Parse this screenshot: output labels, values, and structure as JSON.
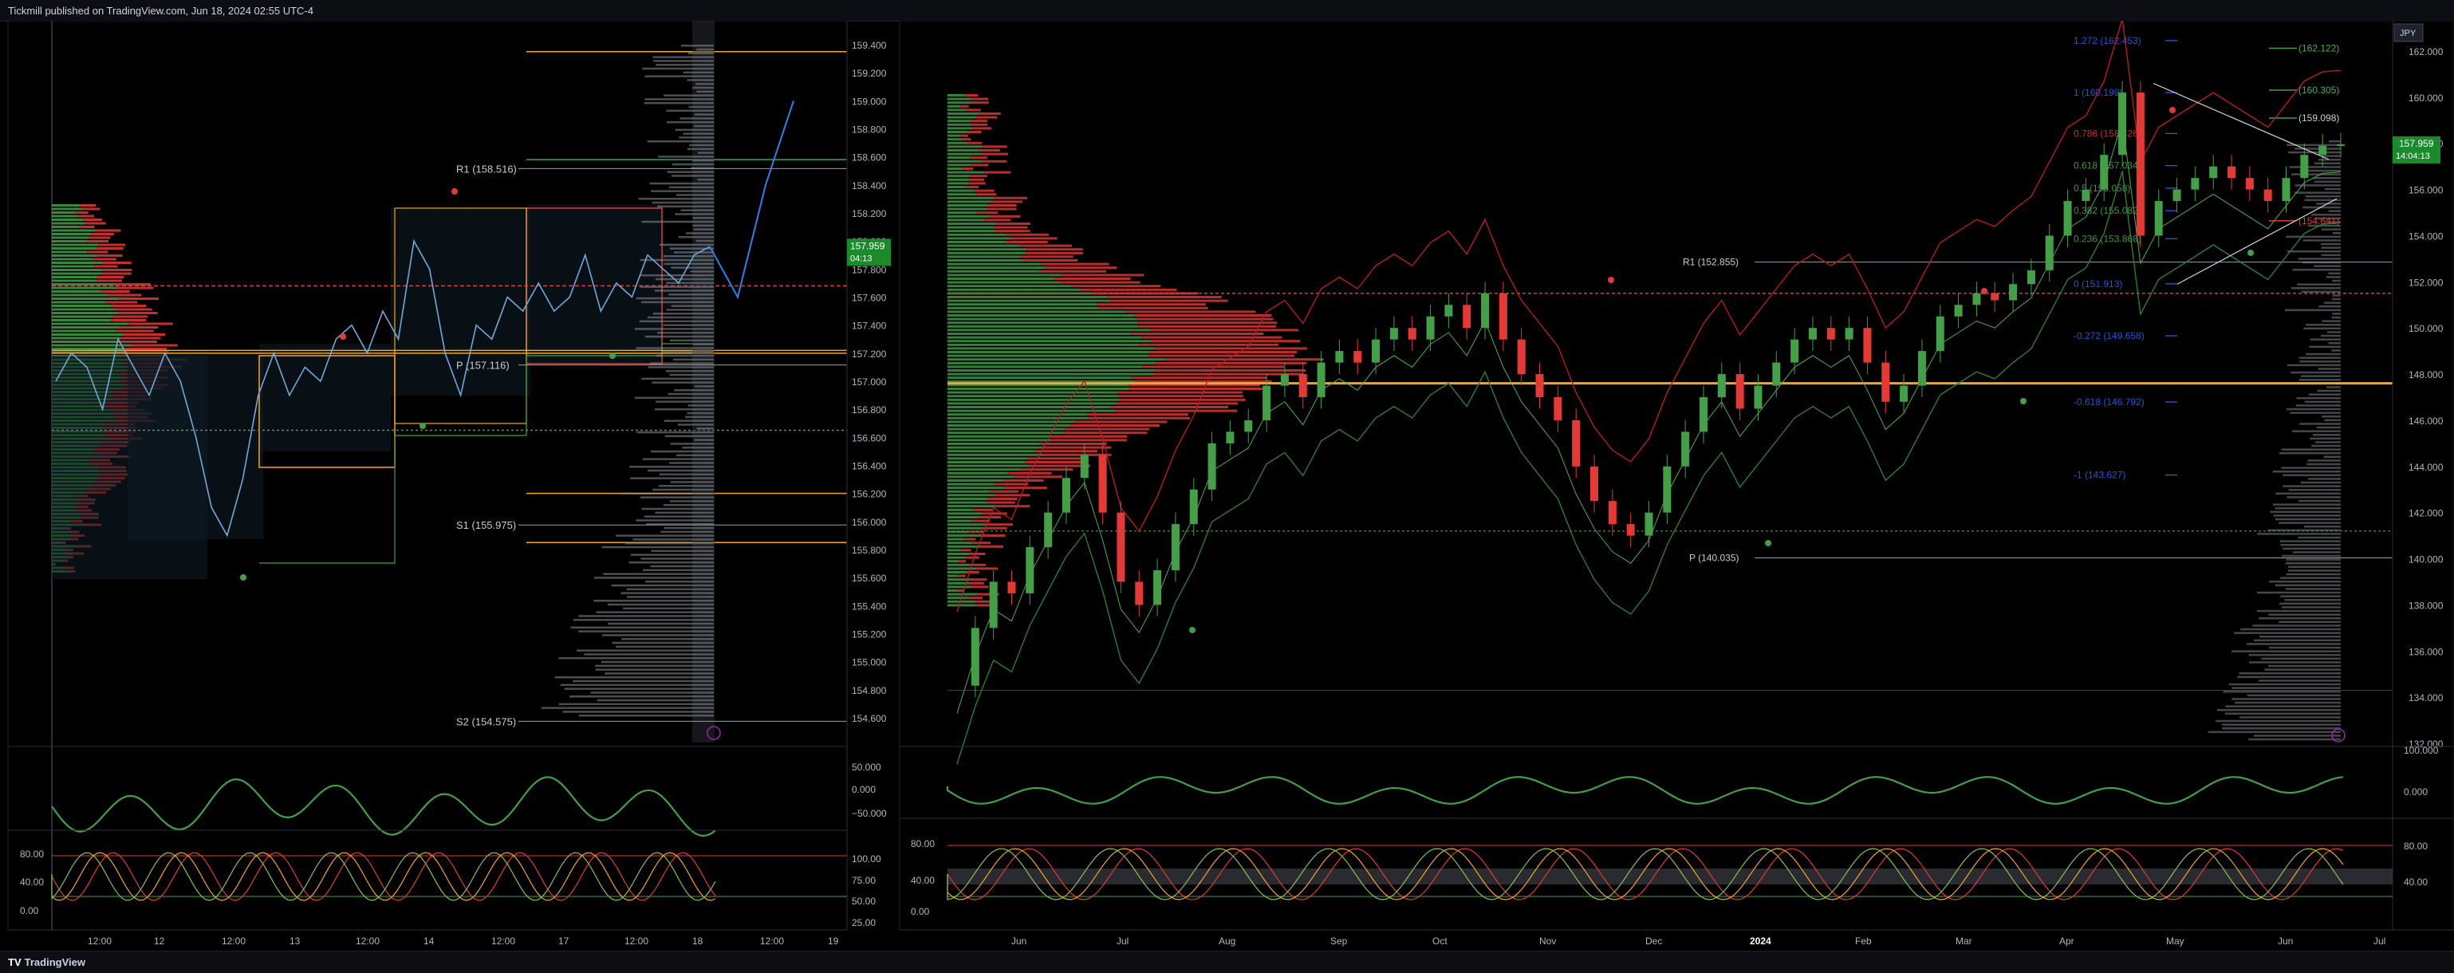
{
  "header": {
    "published": "Tickmill published on TradingView.com, Jun 18, 2024 02:55 UTC-4"
  },
  "footer": {
    "brand": "TradingView"
  },
  "colors": {
    "up": "#43a047",
    "down": "#e53935",
    "orange": "#f5a623",
    "blue": "#2962ff",
    "green_level": "#4caf50",
    "background": "#000000"
  },
  "left_panel": {
    "price_axis": [
      "159.400",
      "159.200",
      "159.000",
      "158.800",
      "158.600",
      "158.400",
      "158.200",
      "158.000",
      "157.800",
      "157.600",
      "157.400",
      "157.200",
      "157.000",
      "156.800",
      "156.600",
      "156.400",
      "156.200",
      "156.000",
      "155.800",
      "155.600",
      "155.400",
      "155.200",
      "155.000",
      "154.800",
      "154.600"
    ],
    "current_price": "157.959",
    "countdown": "04:13",
    "time_axis": [
      "12:00",
      "12",
      "12:00",
      "13",
      "12:00",
      "14",
      "12:00",
      "17",
      "12:00",
      "18",
      "12:00",
      "19"
    ],
    "levels": [
      {
        "label": "R1 (158.516)",
        "price": 158.516
      },
      {
        "label": "P (157.116)",
        "price": 157.116
      },
      {
        "label": "S1 (155.975)",
        "price": 155.975
      },
      {
        "label": "S2 (154.575)",
        "price": 154.575
      }
    ],
    "osc1_axis": [
      "50.000",
      "0.000",
      "−50.000"
    ],
    "osc2_left_axis": [
      "80.00",
      "40.00",
      "0.00"
    ],
    "osc2_right_axis": [
      "100.00",
      "75.00",
      "50.00",
      "25.00"
    ]
  },
  "right_panel": {
    "currency": "JPY",
    "price_axis": [
      "162.000",
      "160.000",
      "158.000",
      "156.000",
      "154.000",
      "152.000",
      "150.000",
      "148.000",
      "146.000",
      "144.000",
      "142.000",
      "140.000",
      "138.000",
      "136.000",
      "134.000",
      "132.000"
    ],
    "current_price": "157.959",
    "countdown": "14:04:13",
    "time_axis": [
      "Jun",
      "Jul",
      "Aug",
      "Sep",
      "Oct",
      "Nov",
      "Dec",
      "2024",
      "Feb",
      "Mar",
      "Apr",
      "May",
      "Jun",
      "Jul"
    ],
    "fib_labels": [
      {
        "label": "1.272 (162.453)",
        "price": 162.453
      },
      {
        "label": "1 (160.199)",
        "price": 160.199
      },
      {
        "label": "0.786 (158.426)",
        "price": 158.426
      },
      {
        "label": "0.618 (157.034)",
        "price": 157.034
      },
      {
        "label": "0.5 (156.058)",
        "price": 156.058
      },
      {
        "label": "0.382 (155.082)",
        "price": 155.082
      },
      {
        "label": "0.236 (153.868)",
        "price": 153.868
      },
      {
        "label": "0 (151.913)",
        "price": 151.913
      },
      {
        "label": "-0.272 (149.658)",
        "price": 149.658
      },
      {
        "label": "-0.618 (146.792)",
        "price": 146.792
      },
      {
        "label": "-1 (143.627)",
        "price": 143.627
      }
    ],
    "pivot_labels": [
      {
        "label": "R1 (152.855)",
        "price": 152.855
      },
      {
        "label": "P (140.035)",
        "price": 140.035
      }
    ],
    "right_tags": [
      {
        "label": "(162.122)",
        "price": 162.122
      },
      {
        "label": "(160.305)",
        "price": 160.305
      },
      {
        "label": "(159.098)",
        "price": 159.098
      },
      {
        "label": "(154.641)",
        "price": 154.641
      }
    ],
    "osc1_axis": [
      "100.000",
      "0.000"
    ],
    "osc2_left_axis": [
      "80.00",
      "40.00",
      "0.00"
    ],
    "osc2_right_axis": [
      "80.00",
      "40.00"
    ]
  },
  "chart_data": [
    {
      "type": "candlestick",
      "title": "",
      "timeframe_axis": [
        "12:00",
        "12",
        "12:00",
        "13",
        "12:00",
        "14",
        "12:00",
        "17",
        "12:00",
        "18",
        "12:00",
        "19"
      ],
      "ylim": [
        154.5,
        159.5
      ],
      "close_series": [
        157.0,
        157.2,
        157.1,
        156.8,
        157.3,
        157.1,
        156.9,
        157.2,
        157.0,
        156.6,
        156.1,
        155.9,
        156.3,
        156.9,
        157.2,
        156.9,
        157.1,
        157.0,
        157.3,
        157.4,
        157.2,
        157.5,
        157.3,
        158.0,
        157.8,
        157.2,
        156.9,
        157.4,
        157.3,
        157.6,
        157.5,
        157.7,
        157.5,
        157.6,
        157.9,
        157.5,
        157.7,
        157.6,
        157.9,
        157.8,
        157.7,
        157.9,
        157.96
      ],
      "projection": [
        157.96,
        157.6,
        158.4,
        159.0
      ],
      "last_price": 157.959
    },
    {
      "type": "candlestick",
      "title": "",
      "timeframe_axis": [
        "Jun",
        "Jul",
        "Aug",
        "Sep",
        "Oct",
        "Nov",
        "Dec",
        "2024",
        "Feb",
        "Mar",
        "Apr",
        "May",
        "Jun",
        "Jul"
      ],
      "ylim": [
        132,
        162.5
      ],
      "close_series": [
        134.5,
        137,
        139,
        138.5,
        140.5,
        142,
        143.5,
        144.5,
        142,
        139,
        138,
        139.5,
        141.5,
        143,
        145,
        145.5,
        146,
        147.5,
        148,
        147,
        148.5,
        149,
        148.5,
        149.5,
        150,
        149.5,
        150.5,
        151,
        150,
        151.5,
        149.5,
        148,
        147,
        146,
        144,
        142.5,
        141.5,
        141,
        142,
        144,
        145.5,
        147,
        148,
        146.5,
        147.5,
        148.5,
        149.5,
        150,
        149.5,
        150,
        148.5,
        146.8,
        147.5,
        149,
        150.5,
        151,
        151.5,
        151.2,
        151.9,
        152.5,
        154,
        155.5,
        156,
        157.5,
        160.2,
        154,
        155.5,
        156,
        156.5,
        157,
        156.5,
        156,
        155.5,
        156.5,
        157.5,
        157.9,
        157.96
      ],
      "last_price": 157.959
    }
  ]
}
